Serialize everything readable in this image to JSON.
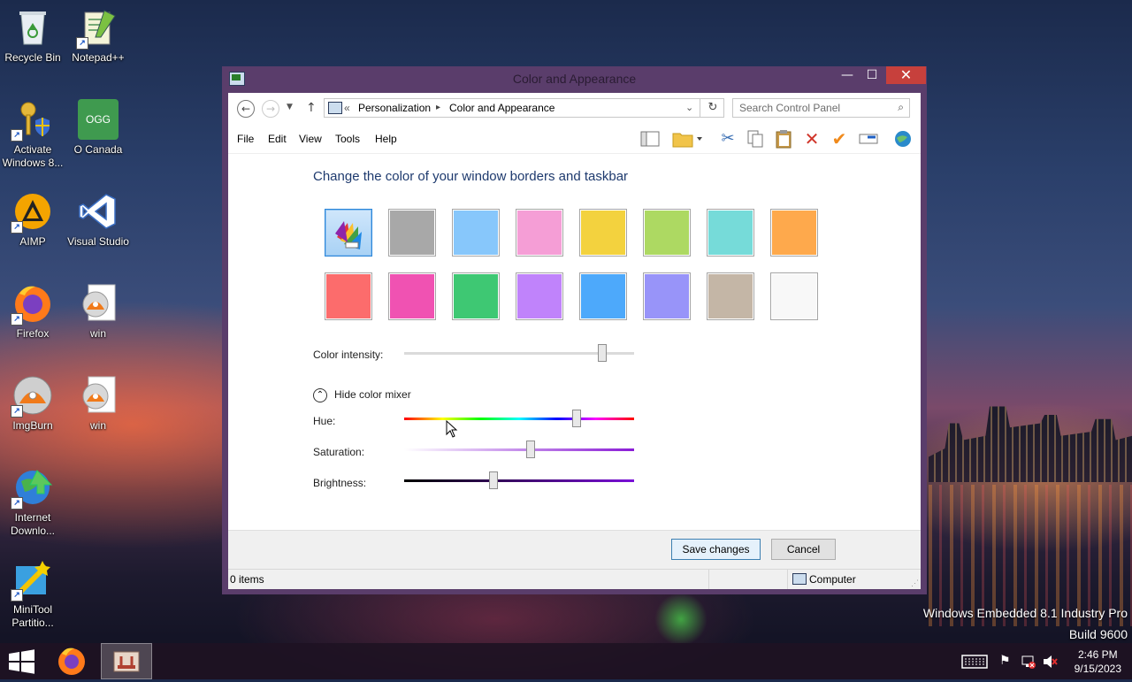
{
  "desktop": {
    "icons": [
      {
        "label": "Recycle Bin"
      },
      {
        "label": "Notepad++"
      },
      {
        "label": "Activate Windows 8..."
      },
      {
        "label": "O Canada",
        "badge": "OGG"
      },
      {
        "label": "AIMP"
      },
      {
        "label": "Visual Studio"
      },
      {
        "label": "Firefox"
      },
      {
        "label": "win"
      },
      {
        "label": "ImgBurn"
      },
      {
        "label": "win"
      },
      {
        "label": "Internet Downlo..."
      },
      {
        "label": "MiniTool Partitio..."
      }
    ],
    "watermark_line1": "Windows Embedded 8.1 Industry Pro",
    "watermark_line2": "Build 9600"
  },
  "window": {
    "title": "Color and Appearance",
    "close_glyph": "✕",
    "minimize_glyph": "—",
    "maximize_glyph": "☐",
    "address": {
      "chevron": "«",
      "crumb1": "Personalization",
      "separator": "▸",
      "crumb2": "Color and Appearance"
    },
    "search_placeholder": "Search Control Panel",
    "menu": {
      "file": "File",
      "edit": "Edit",
      "view": "View",
      "tools": "Tools",
      "help": "Help"
    },
    "heading": "Change the color of your window borders and taskbar",
    "swatches_row1": [
      "#color-picker",
      "#a8a8a8",
      "#87c7fb",
      "#f59ed6",
      "#f3d23e",
      "#add962",
      "#76dbd9",
      "#fea94c"
    ],
    "swatches_row2": [
      "#fc6c6c",
      "#f052b2",
      "#3ec873",
      "#c083fb",
      "#4da9fb",
      "#9894f9",
      "#c4b6a6",
      "#f8f8f8"
    ],
    "intensity_label": "Color intensity:",
    "intensity_value": 0.86,
    "mixer_toggle": "Hide color mixer",
    "hue_label": "Hue:",
    "hue_value": 0.75,
    "saturation_label": "Saturation:",
    "saturation_value": 0.55,
    "brightness_label": "Brightness:",
    "brightness_value": 0.39,
    "save_button": "Save changes",
    "cancel_button": "Cancel",
    "status_items": "0 items",
    "status_location": "Computer"
  },
  "taskbar": {
    "time": "2:46 PM",
    "date": "9/15/2023"
  }
}
